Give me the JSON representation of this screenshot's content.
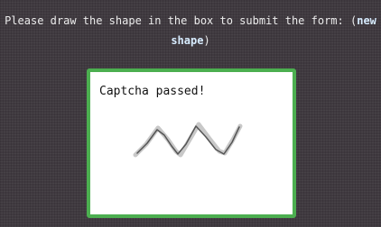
{
  "instructions": {
    "prefix": "Please draw the shape in the box to submit the form: (",
    "link_word_1": "new",
    "link_word_2": "shape",
    "suffix": ")"
  },
  "captcha": {
    "status": "Captcha passed!",
    "shape_icon": "zigzag-stroke",
    "colors": {
      "border": "#4caf50",
      "stroke": "#555555",
      "guide": "#c8c8c8"
    }
  }
}
